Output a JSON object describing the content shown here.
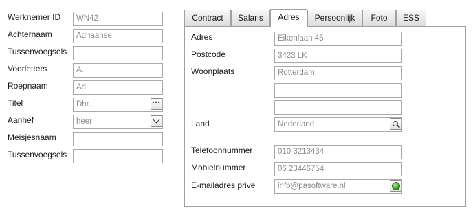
{
  "left_form": {
    "fields": [
      {
        "label": "Werknemer ID",
        "value": "WN42"
      },
      {
        "label": "Achternaam",
        "value": "Adriaanse"
      },
      {
        "label": "Tussenvoegsels",
        "value": ""
      },
      {
        "label": "Voorletters",
        "value": "A."
      },
      {
        "label": "Roepnaam",
        "value": "Ad"
      },
      {
        "label": "Titel",
        "value": "Dhr.",
        "button_icon": "ellipsis-icon"
      },
      {
        "label": "Aanhef",
        "value": "heer",
        "button_icon": "chevron-down-icon"
      },
      {
        "label": "Meisjesnaam",
        "value": ""
      },
      {
        "label": "Tussenvoegsels",
        "value": ""
      }
    ]
  },
  "tabs": [
    {
      "label": "Contract"
    },
    {
      "label": "Salaris"
    },
    {
      "label": "Adres",
      "active": true
    },
    {
      "label": "Persoonlijk"
    },
    {
      "label": "Foto"
    },
    {
      "label": "ESS"
    }
  ],
  "adres_tab": {
    "adres_label": "Adres",
    "adres_value": "Eikenlaan 45",
    "postcode_label": "Postcode",
    "postcode_value": "3423 LK",
    "woonplaats_label": "Woonplaats",
    "woonplaats_value": "Rotterdam",
    "extra_line_1": "",
    "extra_line_2": "",
    "land_label": "Land",
    "land_value": "Nederland",
    "land_button_icon": "search-icon",
    "telefoon_label": "Telefoonnummer",
    "telefoon_value": "010 3213434",
    "mobiel_label": "Mobielnummer",
    "mobiel_value": "06 23446754",
    "email_label": "E-mailadres prive",
    "email_value": "info@pasoftware.nl",
    "email_button_icon": "green-status-orb-icon"
  }
}
